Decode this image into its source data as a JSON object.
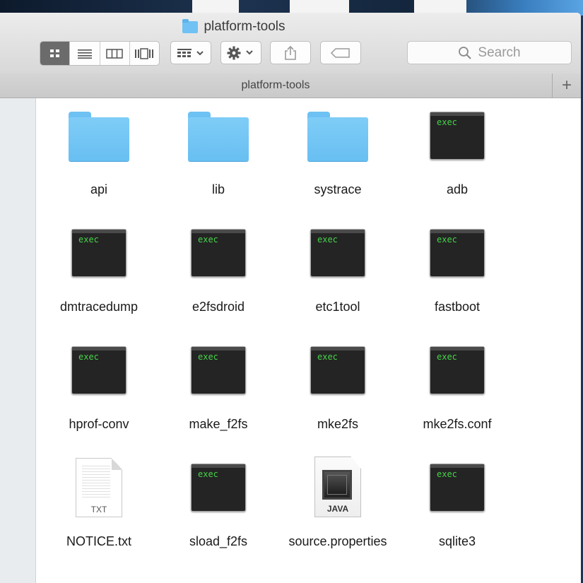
{
  "window": {
    "title": "platform-tools"
  },
  "toolbar": {
    "view_buttons": [
      "icon-view",
      "list-view",
      "column-view",
      "coverflow-view"
    ],
    "arrange_icon": "arrange-icon",
    "action_icon": "gear-icon",
    "share_icon": "share-icon",
    "tags_icon": "tag-icon",
    "search_placeholder": "Search"
  },
  "tab": {
    "label": "platform-tools",
    "add_label": "+"
  },
  "items": [
    {
      "name": "api",
      "kind": "folder"
    },
    {
      "name": "lib",
      "kind": "folder"
    },
    {
      "name": "systrace",
      "kind": "folder"
    },
    {
      "name": "adb",
      "kind": "exec",
      "badge": "exec"
    },
    {
      "name": "dmtracedump",
      "kind": "exec",
      "badge": "exec"
    },
    {
      "name": "e2fsdroid",
      "kind": "exec",
      "badge": "exec"
    },
    {
      "name": "etc1tool",
      "kind": "exec",
      "badge": "exec"
    },
    {
      "name": "fastboot",
      "kind": "exec",
      "badge": "exec"
    },
    {
      "name": "hprof-conv",
      "kind": "exec",
      "badge": "exec"
    },
    {
      "name": "make_f2fs",
      "kind": "exec",
      "badge": "exec"
    },
    {
      "name": "mke2fs",
      "kind": "exec",
      "badge": "exec"
    },
    {
      "name": "mke2fs.conf",
      "kind": "exec",
      "badge": "exec"
    },
    {
      "name": "NOTICE.txt",
      "kind": "text",
      "badge": "TXT"
    },
    {
      "name": "sload_f2fs",
      "kind": "exec",
      "badge": "exec"
    },
    {
      "name": "source.properties",
      "kind": "java",
      "badge": "JAVA"
    },
    {
      "name": "sqlite3",
      "kind": "exec",
      "badge": "exec"
    }
  ]
}
